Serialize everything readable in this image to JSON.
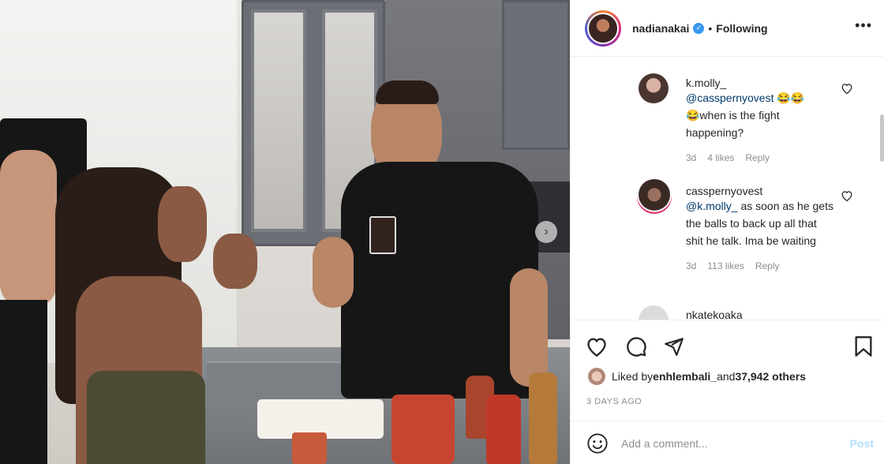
{
  "post": {
    "username": "nadianakai",
    "verified_glyph": "✓",
    "dot": "•",
    "follow_status": "Following",
    "more_glyph": "•••",
    "carousel_next_glyph": "›"
  },
  "comments": [
    {
      "username": "k.molly_",
      "mention": "@casspernyovest",
      "text_line_emoji": " 😂😂",
      "text_rest": "😂when is the fight happening?",
      "time": "3d",
      "likes": "4 likes",
      "reply": "Reply"
    },
    {
      "username": "casspernyovest",
      "mention": "@k.molly_",
      "text_rest": " as soon as he gets the balls to back up all that shit he talk. Ima be waiting",
      "time": "3d",
      "likes": "113 likes",
      "reply": "Reply"
    },
    {
      "username": "nkatekoaka"
    }
  ],
  "likes": {
    "prefix": "Liked by ",
    "user": "enhlembali_",
    "middle": " and ",
    "count": "37,942 others"
  },
  "time_ago": "3 DAYS AGO",
  "add_comment": {
    "placeholder": "Add a comment...",
    "post_label": "Post"
  },
  "colors": {
    "link": "#00376b",
    "verified": "#3897f0",
    "post_disabled": "#b2dffc"
  },
  "icons": [
    "heart-icon",
    "comment-icon",
    "share-icon",
    "bookmark-icon",
    "emoji-icon",
    "more-icon",
    "verified-icon"
  ]
}
